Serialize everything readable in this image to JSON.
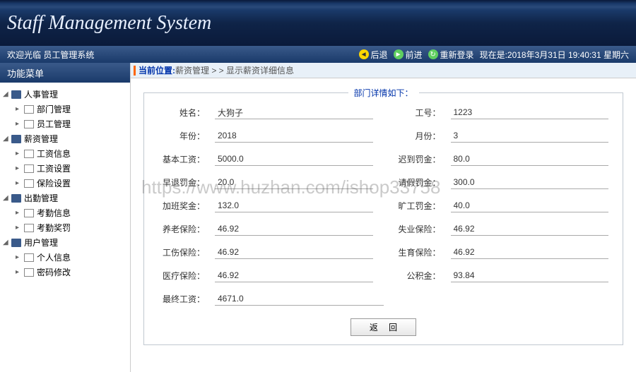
{
  "header": {
    "title": "Staff Management System"
  },
  "topbar": {
    "welcome": "欢迎光临 员工管理系统",
    "back": "后退",
    "forward": "前进",
    "relogin": "重新登录",
    "datetime": "现在是:2018年3月31日 19:40:31 星期六"
  },
  "sidebar": {
    "title": "功能菜单",
    "groups": [
      {
        "label": "人事管理",
        "children": [
          {
            "label": "部门管理"
          },
          {
            "label": "员工管理"
          }
        ]
      },
      {
        "label": "薪资管理",
        "children": [
          {
            "label": "工资信息"
          },
          {
            "label": "工资设置"
          },
          {
            "label": "保险设置"
          }
        ]
      },
      {
        "label": "出勤管理",
        "children": [
          {
            "label": "考勤信息"
          },
          {
            "label": "考勤奖罚"
          }
        ]
      },
      {
        "label": "用户管理",
        "children": [
          {
            "label": "个人信息"
          },
          {
            "label": "密码修改"
          }
        ]
      }
    ]
  },
  "breadcrumb": {
    "label": "当前位置:",
    "path": " 薪资管理 > > 显示薪资详细信息"
  },
  "form": {
    "legend": "部门详情如下：",
    "fields": {
      "name": {
        "label": "姓名：",
        "value": "大狗子"
      },
      "empno": {
        "label": "工号：",
        "value": "1223"
      },
      "year": {
        "label": "年份：",
        "value": "2018"
      },
      "month": {
        "label": "月份：",
        "value": "3"
      },
      "base": {
        "label": "基本工资：",
        "value": "5000.0"
      },
      "late": {
        "label": "迟到罚金：",
        "value": "80.0"
      },
      "early": {
        "label": "早退罚金：",
        "value": "20.0"
      },
      "leave": {
        "label": "请假罚金：",
        "value": "300.0"
      },
      "ot": {
        "label": "加班奖金：",
        "value": "132.0"
      },
      "absent": {
        "label": "旷工罚金：",
        "value": "40.0"
      },
      "pension": {
        "label": "养老保险：",
        "value": "46.92"
      },
      "unemp": {
        "label": "失业保险：",
        "value": "46.92"
      },
      "injury": {
        "label": "工伤保险：",
        "value": "46.92"
      },
      "birth": {
        "label": "生育保险：",
        "value": "46.92"
      },
      "medical": {
        "label": "医疗保险：",
        "value": "46.92"
      },
      "fund": {
        "label": "公积金：",
        "value": "93.84"
      },
      "final": {
        "label": "最终工资：",
        "value": "4671.0"
      }
    },
    "back_btn": "返 回"
  },
  "watermark": "https://www.huzhan.com/ishop33758"
}
